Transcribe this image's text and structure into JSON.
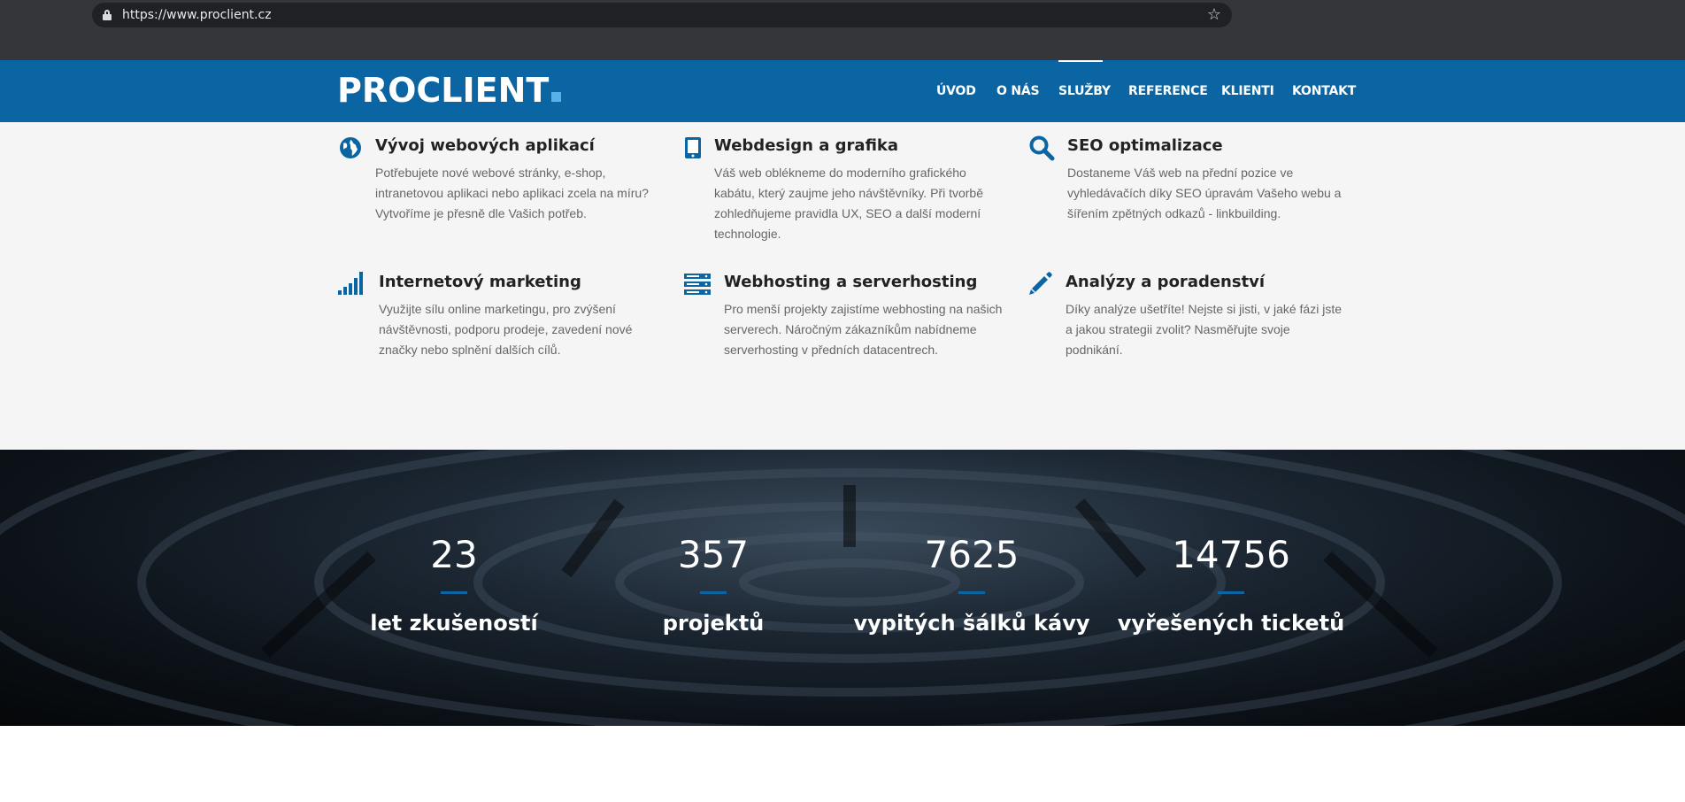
{
  "browser": {
    "url": "https://www.proclient.cz"
  },
  "header": {
    "logo": "PROCLIENT",
    "nav": [
      {
        "label": "ÚVOD"
      },
      {
        "label": "O NÁS"
      },
      {
        "label": "SLUŽBY",
        "active": true
      },
      {
        "label": "REFERENCE"
      },
      {
        "label": "KLIENTI"
      },
      {
        "label": "KONTAKT"
      }
    ]
  },
  "services": [
    {
      "icon": "globe-icon",
      "title": "Vývoj webových aplikací",
      "description": "Potřebujete nové webové stránky, e-shop, intranetovou aplikaci nebo aplikaci zcela na míru? Vytvoříme je přesně dle Vašich potřeb."
    },
    {
      "icon": "tablet-icon",
      "title": "Webdesign a grafika",
      "description": "Váš web oblékneme do moderního grafického kabátu, který zaujme jeho návštěvníky. Při tvorbě zohledňujeme pravidla UX, SEO a další moderní technologie."
    },
    {
      "icon": "search-icon",
      "title": "SEO optimalizace",
      "description": "Dostaneme Váš web na přední pozice ve vyhledávačích díky SEO úpravám Vašeho webu a šířením zpětných odkazů - linkbuilding."
    },
    {
      "icon": "signal-bars-icon",
      "title": "Internetový marketing",
      "description": "Využijte sílu online marketingu, pro zvýšení návštěvnosti, podporu prodeje, zavedení nové značky nebo splnění dalších cílů."
    },
    {
      "icon": "server-icon",
      "title": "Webhosting a serverhosting",
      "description": "Pro menší projekty zajistíme webhosting na našich serverech. Náročným zákazníkům nabídneme serverhosting v předních datacentrech."
    },
    {
      "icon": "pencil-icon",
      "title": "Analýzy a poradenství",
      "description": "Díky analýze ušetříte! Nejste si jisti, v jaké fázi jste a jakou strategii zvolit? Nasměřujte svoje podnikání."
    }
  ],
  "stats": [
    {
      "value": "23",
      "label": "let zkušeností"
    },
    {
      "value": "357",
      "label": "projektů"
    },
    {
      "value": "7625",
      "label": "vypitých šálků kávy"
    },
    {
      "value": "14756",
      "label": "vyřešených ticketů"
    }
  ],
  "colors": {
    "brand": "#0a65a2",
    "accent": "#5ab0e8"
  }
}
